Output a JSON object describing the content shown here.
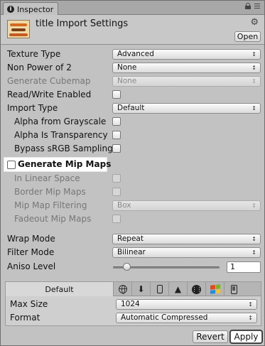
{
  "tab": {
    "icon": "info-icon",
    "label": "Inspector"
  },
  "header": {
    "title": "title Import Settings",
    "open_label": "Open"
  },
  "properties": {
    "texture_type": {
      "label": "Texture Type",
      "value": "Advanced"
    },
    "non_power_of_2": {
      "label": "Non Power of 2",
      "value": "None"
    },
    "generate_cubemap": {
      "label": "Generate Cubemap",
      "value": "None"
    },
    "read_write": {
      "label": "Read/Write Enabled"
    },
    "import_type": {
      "label": "Import Type",
      "value": "Default"
    },
    "alpha_from_grayscale": {
      "label": "Alpha from Grayscale"
    },
    "alpha_is_transparency": {
      "label": "Alpha Is Transparency"
    },
    "bypass_srgb": {
      "label": "Bypass sRGB Sampling"
    },
    "generate_mip_maps": {
      "label": "Generate Mip Maps"
    },
    "in_linear_space": {
      "label": "In Linear Space"
    },
    "border_mip_maps": {
      "label": "Border Mip Maps"
    },
    "mip_map_filtering": {
      "label": "Mip Map Filtering",
      "value": "Box"
    },
    "fadeout_mip_maps": {
      "label": "Fadeout Mip Maps"
    },
    "wrap_mode": {
      "label": "Wrap Mode",
      "value": "Repeat"
    },
    "filter_mode": {
      "label": "Filter Mode",
      "value": "Bilinear"
    },
    "aniso_level": {
      "label": "Aniso Level",
      "value": "1"
    }
  },
  "platform": {
    "default_tab": "Default",
    "icons": [
      "web-icon",
      "download-icon",
      "phone-icon",
      "android-icon",
      "blackberry-icon",
      "windows-icon",
      "windows-phone-icon"
    ],
    "max_size": {
      "label": "Max Size",
      "value": "1024"
    },
    "format": {
      "label": "Format",
      "value": "Automatic Compressed"
    }
  },
  "footer": {
    "revert_label": "Revert",
    "apply_label": "Apply"
  }
}
